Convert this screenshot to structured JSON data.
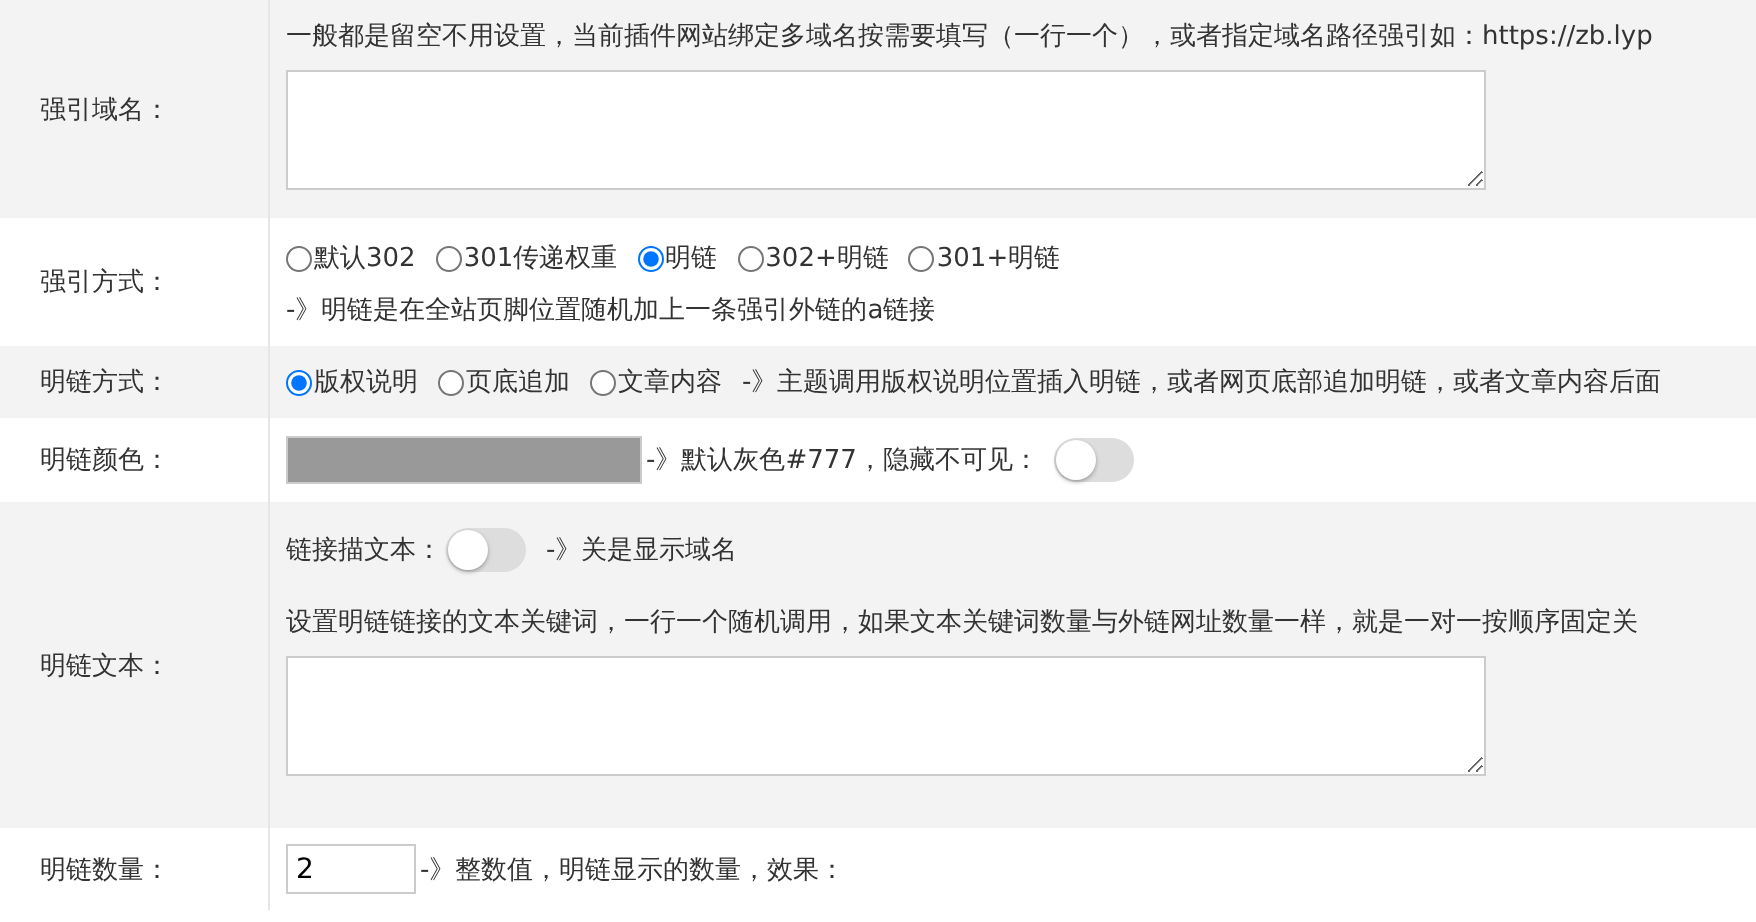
{
  "rows": [
    {
      "kind": "textarea",
      "label": "强引域名：",
      "hint": "一般都是留空不用设置，当前插件网站绑定多域名按需要填写（一行一个），或者指定域名路径强引如：https://zb.lyp"
    },
    {
      "kind": "radios_stacked",
      "label": "强引方式：",
      "options": [
        {
          "label": "默认302",
          "selected": false
        },
        {
          "label": "301传递权重",
          "selected": false
        },
        {
          "label": "明链",
          "selected": true
        },
        {
          "label": "302+明链",
          "selected": false
        },
        {
          "label": "301+明链",
          "selected": false
        }
      ],
      "note": "-》明链是在全站页脚位置随机加上一条强引外链的a链接"
    },
    {
      "kind": "radios_inline",
      "label": "明链方式：",
      "options": [
        {
          "label": "版权说明",
          "selected": true
        },
        {
          "label": "页底追加",
          "selected": false
        },
        {
          "label": "文章内容",
          "selected": false
        }
      ],
      "note": "-》主题调用版权说明位置插入明链，或者网页底部追加明链，或者文章内容后面"
    },
    {
      "kind": "color",
      "label": "明链颜色：",
      "note": "-》默认灰色#777，隐藏不可见：",
      "toggle": {
        "on": false
      }
    },
    {
      "kind": "text",
      "label": "明链文本：",
      "toggle_label": "链接描文本：",
      "toggle": {
        "on": false
      },
      "toggle_note": "-》关是显示域名",
      "hint": "设置明链链接的文本关键词，一行一个随机调用，如果文本关键词数量与外链网址数量一样，就是一对一按顺序固定关"
    },
    {
      "kind": "number",
      "label": "明链数量：",
      "value": "2",
      "note": "-》整数值，明链显示的数量，效果："
    }
  ]
}
